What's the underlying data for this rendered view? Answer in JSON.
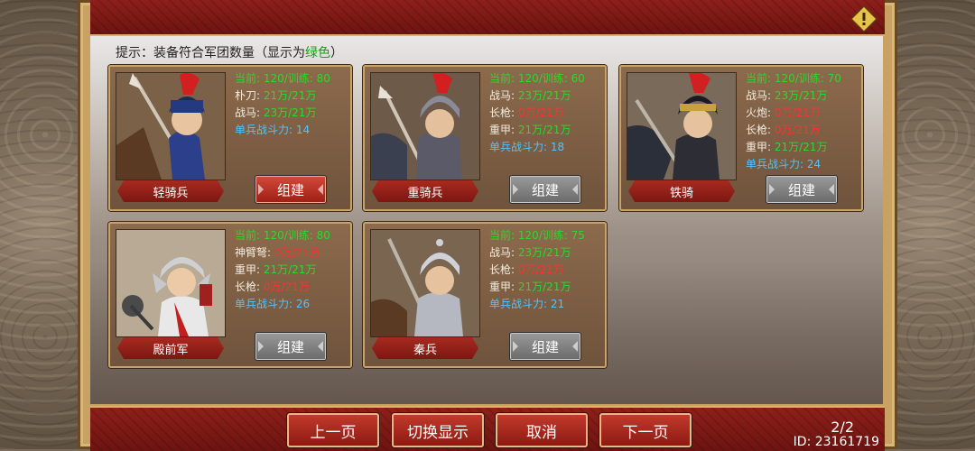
{
  "hint": {
    "prefix": "提示：装备符合军团数量（显示为",
    "highlight": "绿色",
    "suffix": "）"
  },
  "colors": {
    "ok": "#2cd82c",
    "lack": "#ff3030",
    "power": "#4fc4ff"
  },
  "units": [
    {
      "name": "轻骑兵",
      "build_label": "组建",
      "build_enabled": true,
      "lines": [
        {
          "label": "当前: 120/训练: 80",
          "status": "ok"
        },
        {
          "label": "朴刀: ",
          "value": "21万/21万",
          "status": "ok"
        },
        {
          "label": "战马: ",
          "value": "23万/21万",
          "status": "ok"
        },
        {
          "label": "单兵战斗力: 14",
          "status": "power"
        }
      ]
    },
    {
      "name": "重骑兵",
      "build_label": "组建",
      "build_enabled": false,
      "lines": [
        {
          "label": "当前: 120/训练: 60",
          "status": "ok"
        },
        {
          "label": "战马: ",
          "value": "23万/21万",
          "status": "ok"
        },
        {
          "label": "长枪: ",
          "value": "0万/21万",
          "status": "lack"
        },
        {
          "label": "重甲: ",
          "value": "21万/21万",
          "status": "ok"
        },
        {
          "label": "单兵战斗力: 18",
          "status": "power"
        }
      ]
    },
    {
      "name": "铁骑",
      "build_label": "组建",
      "build_enabled": false,
      "lines": [
        {
          "label": "当前: 120/训练: 70",
          "status": "ok"
        },
        {
          "label": "战马: ",
          "value": "23万/21万",
          "status": "ok"
        },
        {
          "label": "火炮: ",
          "value": "0万/21万",
          "status": "lack"
        },
        {
          "label": "长枪: ",
          "value": "0万/21万",
          "status": "lack"
        },
        {
          "label": "重甲: ",
          "value": "21万/21万",
          "status": "ok"
        },
        {
          "label": "单兵战斗力: 24",
          "status": "power"
        }
      ]
    },
    {
      "name": "殿前军",
      "build_label": "组建",
      "build_enabled": false,
      "lines": [
        {
          "label": "当前: 120/训练: 80",
          "status": "ok"
        },
        {
          "label": "神臂弩: ",
          "value": "0万/21万",
          "status": "lack"
        },
        {
          "label": "重甲: ",
          "value": "21万/21万",
          "status": "ok"
        },
        {
          "label": "长枪: ",
          "value": "0万/21万",
          "status": "lack"
        },
        {
          "label": "单兵战斗力: 26",
          "status": "power"
        }
      ]
    },
    {
      "name": "秦兵",
      "build_label": "组建",
      "build_enabled": false,
      "lines": [
        {
          "label": "当前: 120/训练: 75",
          "status": "ok"
        },
        {
          "label": "战马: ",
          "value": "23万/21万",
          "status": "ok"
        },
        {
          "label": "长枪: ",
          "value": "0万/21万",
          "status": "lack"
        },
        {
          "label": "重甲: ",
          "value": "21万/21万",
          "status": "ok"
        },
        {
          "label": "单兵战斗力: 21",
          "status": "power"
        }
      ]
    }
  ],
  "footer": {
    "prev": "上一页",
    "toggle": "切换显示",
    "cancel": "取消",
    "next": "下一页",
    "page": "2/2",
    "uid": "ID: 23161719"
  }
}
